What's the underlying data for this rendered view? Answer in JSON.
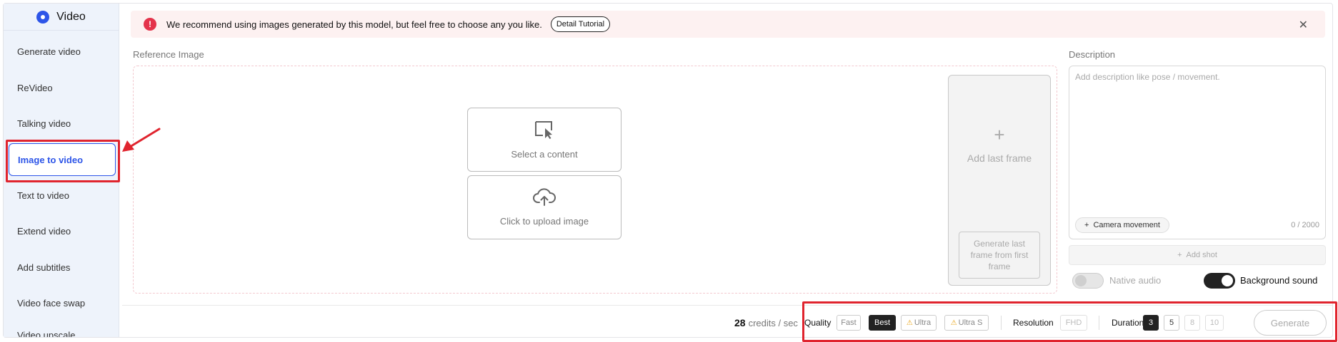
{
  "sidebar": {
    "title": "Video",
    "items": [
      {
        "label": "Generate video"
      },
      {
        "label": "ReVideo"
      },
      {
        "label": "Talking video"
      },
      {
        "label": "Image to video",
        "active": true
      },
      {
        "label": "Text to video"
      },
      {
        "label": "Extend video"
      },
      {
        "label": "Add subtitles"
      },
      {
        "label": "Video face swap"
      },
      {
        "label": "Video upscale"
      }
    ]
  },
  "banner": {
    "text": "We recommend using images generated by this model, but feel free to choose any you like.",
    "tutorial_label": "Detail Tutorial"
  },
  "reference": {
    "label": "Reference Image",
    "select_label": "Select a content",
    "upload_label": "Click to upload image",
    "last_frame_label": "Add last frame",
    "generate_last_label": "Generate last frame from first frame"
  },
  "description": {
    "label": "Description",
    "placeholder": "Add description like pose / movement.",
    "value": "",
    "camera_label": "Camera movement",
    "counter": "0 / 2000",
    "add_shot_label": "Add shot",
    "native_audio_label": "Native audio",
    "native_audio_on": false,
    "background_sound_label": "Background sound",
    "background_sound_on": true
  },
  "footer": {
    "credits_value": "28",
    "credits_unit": "credits / sec",
    "quality_label": "Quality",
    "quality_options": [
      "Fast",
      "Best",
      "Ultra",
      "Ultra S"
    ],
    "quality_selected": "Best",
    "resolution_label": "Resolution",
    "resolution_value": "FHD",
    "duration_label": "Duration",
    "duration_options": [
      "3",
      "5",
      "8",
      "10"
    ],
    "duration_selected": "3",
    "generate_label": "Generate"
  },
  "colors": {
    "accent": "#2d55e8",
    "highlight": "#e0242e",
    "banner_bg": "#fdf1f1",
    "info": "#e4334b"
  }
}
